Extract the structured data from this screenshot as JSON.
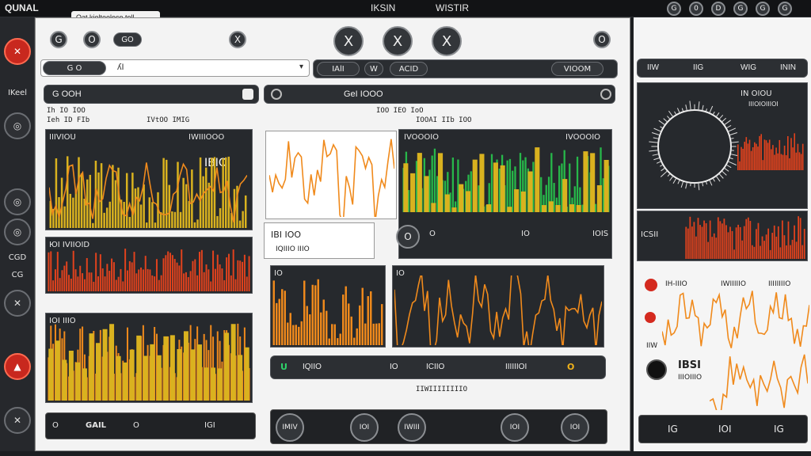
{
  "top_bar": {
    "left_text": "QUNAL",
    "center_left": "IKSIN",
    "center_right": "WISTIR",
    "right_icons": [
      "G",
      "0",
      "D",
      "G",
      "G",
      "G"
    ]
  },
  "tooltip": "Oat kielteeloco toll",
  "left_rail": {
    "labels": [
      "IKeel",
      "CGD",
      "CG"
    ],
    "buttons": [
      "close-icon",
      "target-icon",
      "target-icon",
      "target-icon",
      "bell-icon",
      "close-icon",
      "close-icon"
    ]
  },
  "toolbar": {
    "left": [
      "G",
      "O",
      "GO",
      "X"
    ],
    "circles": [
      "X",
      "X",
      "X"
    ],
    "right": [
      "O",
      "WoOM"
    ],
    "tab_input": "ʎI",
    "tab_items": [
      "IAlI",
      "W",
      "ACID",
      "VIOOM"
    ]
  },
  "panel_row1": {
    "left_head": "G OOH",
    "left_sub": [
      "Ih  IO  IOO",
      "Ieh ID  FIb",
      "IVtOO  IMIG"
    ],
    "center_head": "GeI IOOO",
    "center_sub": [
      "IOO  IEO  IoO",
      "IOOAI  IIb  IOO"
    ],
    "chart1_title": "IIIVIOU",
    "chart1_right": "IWIIIOOO",
    "chart1_value": "IBIO",
    "chart2_label": "IBI IOO",
    "chart2_sub": "IQIIIO IIIO",
    "chart3_title": "IVOOOIO",
    "chart3_right": "IVOOOIO",
    "chart3_buttons": [
      "O",
      "O",
      "IO",
      "IOIS"
    ]
  },
  "panel_row2": {
    "chart4_title": "ЮI IVIIOID",
    "chart5_title": "IO",
    "chart6_title": "IO"
  },
  "panel_row3": {
    "chart7_title": "IOI IIIO",
    "legend": [
      "U",
      "IQIIO",
      "IO",
      "ICIIO",
      "IIIIIIOI",
      "O"
    ],
    "subtitle": "IIWIIIIIIIIO"
  },
  "bottom_bar": {
    "left": [
      "O",
      "GAIL",
      "O",
      "IGI"
    ],
    "center": [
      "IMIV",
      "IOI",
      "IWIII",
      "IOI",
      "IOI"
    ],
    "right": [
      "IG",
      "IOI",
      "IG"
    ]
  },
  "right_panel": {
    "head": [
      "IIW",
      "IIG",
      "WIG",
      "ININ"
    ],
    "polar_title": "IN OIOU",
    "polar_sub": "IIIOIOIIIOI",
    "bar_label": "ICSII",
    "line_labels": [
      "IH-IIIO",
      "IWIIIIIO",
      "IIIIIIIIO"
    ],
    "line_axis": "IIW",
    "line2_label": "IBSI",
    "line2_sub": "IIIOIIIO"
  },
  "colors": {
    "orange": "#f08a1c",
    "red_orange": "#e2421d",
    "green": "#27b84a",
    "yellow": "#d9b21f",
    "red": "#d42a1f",
    "panel_dark": "#26292d"
  }
}
